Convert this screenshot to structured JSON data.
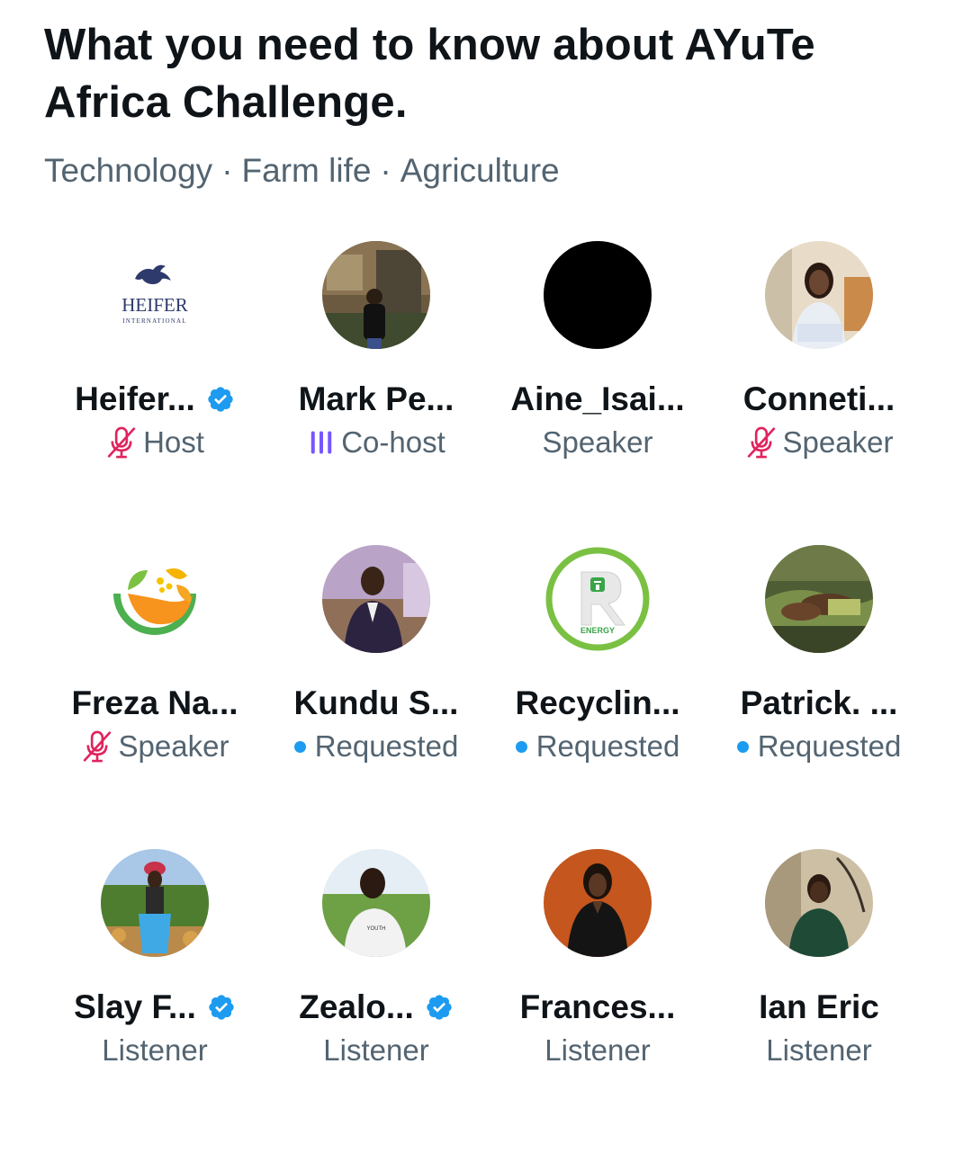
{
  "space": {
    "title": "What you need to know about AYuTe Africa Challenge.",
    "topics": [
      "Technology",
      "Farm life",
      "Agriculture"
    ],
    "topic_separator": "·"
  },
  "colors": {
    "text_primary": "#0f1419",
    "text_secondary": "#536471",
    "verified_blue": "#1d9bf0",
    "muted_mic_pink": "#e0245e",
    "speaking_purple": "#7856ff"
  },
  "participants": [
    {
      "name": "Heifer...",
      "role": "Host",
      "verified": true,
      "status_icon": "mic-off-icon",
      "avatar": "heifer-international-logo"
    },
    {
      "name": "Mark Pe...",
      "role": "Co-host",
      "verified": false,
      "status_icon": "speaking-bars-icon",
      "avatar": "photo"
    },
    {
      "name": "Aine_Isai...",
      "role": "Speaker",
      "verified": false,
      "status_icon": "",
      "avatar": "black-circle"
    },
    {
      "name": "Conneti...",
      "role": "Speaker",
      "verified": false,
      "status_icon": "mic-off-icon",
      "avatar": "photo"
    },
    {
      "name": "Freza Na...",
      "role": "Speaker",
      "verified": false,
      "status_icon": "mic-off-icon",
      "avatar": "fruit-logo"
    },
    {
      "name": "Kundu S...",
      "role": "Requested",
      "verified": false,
      "status_icon": "requested-dot",
      "avatar": "photo"
    },
    {
      "name": "Recyclin...",
      "role": "Requested",
      "verified": false,
      "status_icon": "requested-dot",
      "avatar": "r-energy-logo"
    },
    {
      "name": "Patrick. ...",
      "role": "Requested",
      "verified": false,
      "status_icon": "requested-dot",
      "avatar": "photo"
    },
    {
      "name": "Slay F...",
      "role": "Listener",
      "verified": true,
      "status_icon": "",
      "avatar": "photo"
    },
    {
      "name": "Zealo...",
      "role": "Listener",
      "verified": true,
      "status_icon": "",
      "avatar": "photo"
    },
    {
      "name": "Frances...",
      "role": "Listener",
      "verified": false,
      "status_icon": "",
      "avatar": "photo"
    },
    {
      "name": "Ian Eric",
      "role": "Listener",
      "verified": false,
      "status_icon": "",
      "avatar": "photo"
    }
  ]
}
